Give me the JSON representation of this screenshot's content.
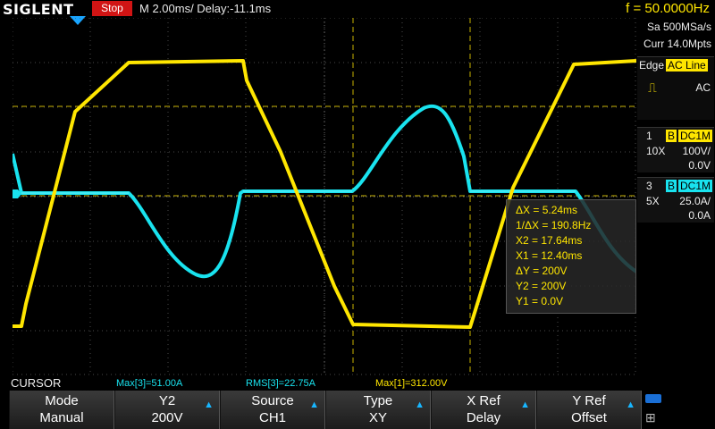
{
  "header": {
    "brand": "SIGLENT",
    "run_state": "Stop",
    "timebase": "M 2.00ms/ Delay:-11.1ms",
    "frequency": "f = 50.0000Hz"
  },
  "acquisition": {
    "sample_rate": "Sa 500MSa/s",
    "memory": "Curr 14.0Mpts"
  },
  "trigger": {
    "label": "Edge",
    "source": "AC Line",
    "coupling": "AC"
  },
  "channels": [
    {
      "num": "1",
      "bw": "B",
      "coupling": "DC1M",
      "probe": "10X",
      "scale": "100V/",
      "offset": "0.0V",
      "color": "#ffe600"
    },
    {
      "num": "3",
      "bw": "B",
      "coupling": "DC1M",
      "probe": "5X",
      "scale": "25.0A/",
      "offset": "0.0A",
      "color": "#19e3ef"
    }
  ],
  "ground_marker": "3",
  "cursor_readout": {
    "dx": "ΔX = 5.24ms",
    "inv_dx": "1/ΔX = 190.8Hz",
    "x2": "X2 = 17.64ms",
    "x1": "X1 = 12.40ms",
    "dy": "ΔY = 200V",
    "y2": "Y2 = 200V",
    "y1": "Y1 = 0.0V"
  },
  "status_bar": {
    "mode": "CURSOR",
    "m1": "Max[3]=51.00A",
    "m2": "RMS[3]=22.75A",
    "m3": "Max[1]=312.00V"
  },
  "softkeys": [
    {
      "title": "Mode",
      "value": "Manual"
    },
    {
      "title": "Y2",
      "value": "200V"
    },
    {
      "title": "Source",
      "value": "CH1"
    },
    {
      "title": "Type",
      "value": "XY"
    },
    {
      "title": "X Ref",
      "value": "Delay"
    },
    {
      "title": "Y Ref",
      "value": "Offset"
    }
  ],
  "colors": {
    "ch1": "#ffe600",
    "ch3": "#19e3ef",
    "grid": "#5a5a5a",
    "cursor": "#d8c000"
  }
}
